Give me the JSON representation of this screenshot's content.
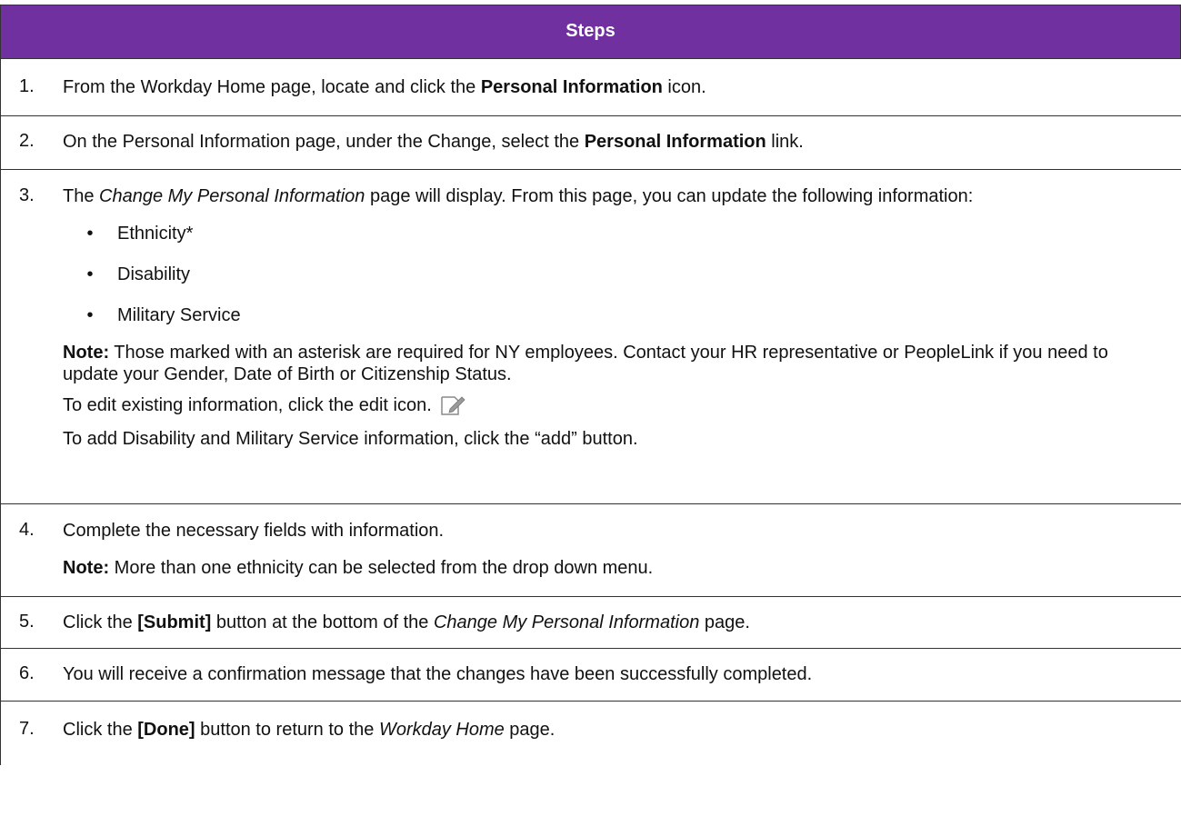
{
  "header": {
    "title": "Steps"
  },
  "steps": [
    {
      "num": "1.",
      "pre": "From the Workday Home page, locate and click the ",
      "bold": "Personal Information",
      "post": " icon."
    },
    {
      "num": "2.",
      "pre": "On the Personal Information page, under the Change, select the ",
      "bold": "Personal Information",
      "post": " link."
    },
    {
      "num": "3.",
      "pre": "The ",
      "italic": "Change My Personal Information",
      "post": " page will display. From this page, you can update the following information:",
      "bullets": [
        "Ethnicity*",
        "Disability",
        "Military Service"
      ],
      "note_label": "Note:",
      "note_text": "  Those marked with an asterisk are required for NY employees. Contact your HR representative or PeopleLink if you need to update your Gender, Date of Birth or Citizenship Status.",
      "edit_line": "To edit existing information, click the edit icon.",
      "add_line": "To add Disability and Military Service information, click the “add” button."
    },
    {
      "num": "4.",
      "text": "Complete the necessary fields with information.",
      "note_label": "Note:",
      "note_text": "  More than one ethnicity can be selected from the drop down menu."
    },
    {
      "num": "5.",
      "pre": "Click the ",
      "bold": "[Submit]",
      "mid": " button at the bottom of the ",
      "italic": "Change My Personal Information",
      "post": " page."
    },
    {
      "num": "6.",
      "text": "You will receive a confirmation message that the changes have been successfully completed."
    },
    {
      "num": "7.",
      "pre": "Click the ",
      "bold": "[Done]",
      "mid": " button to return to the ",
      "italic": "Workday Home",
      "post": " page."
    }
  ],
  "icons": {
    "edit": "edit-pencil-icon"
  },
  "colors": {
    "header_bg": "#7030a0",
    "header_text": "#ffffff"
  }
}
